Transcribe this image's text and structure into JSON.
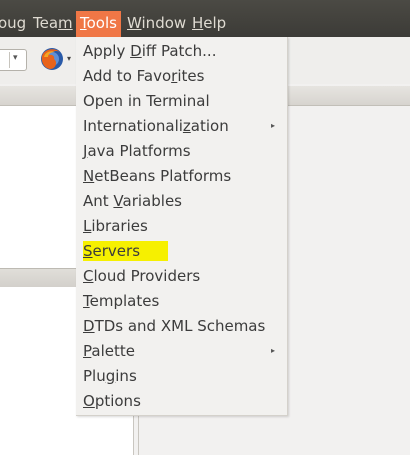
{
  "menubar": {
    "items": [
      {
        "prefix": "",
        "mnemonic": "",
        "suffix": "oug"
      },
      {
        "prefix": "Tea",
        "mnemonic": "m",
        "suffix": ""
      },
      {
        "prefix": "",
        "mnemonic": "T",
        "suffix": "ools"
      },
      {
        "prefix": "",
        "mnemonic": "W",
        "suffix": "indow"
      },
      {
        "prefix": "",
        "mnemonic": "H",
        "suffix": "elp"
      }
    ]
  },
  "tools_menu": {
    "items": [
      {
        "prefix": "Apply ",
        "mnemonic": "D",
        "suffix": "iff Patch..."
      },
      {
        "prefix": "Add to Favo",
        "mnemonic": "r",
        "suffix": "ites"
      },
      {
        "prefix": "Open in Terminal",
        "mnemonic": "",
        "suffix": ""
      },
      {
        "prefix": "Internationali",
        "mnemonic": "z",
        "suffix": "ation",
        "submenu": "▸"
      },
      {
        "prefix": "",
        "mnemonic": "J",
        "suffix": "ava Platforms"
      },
      {
        "prefix": "",
        "mnemonic": "N",
        "suffix": "etBeans Platforms"
      },
      {
        "prefix": "Ant ",
        "mnemonic": "V",
        "suffix": "ariables"
      },
      {
        "prefix": "",
        "mnemonic": "L",
        "suffix": "ibraries"
      },
      {
        "prefix": "",
        "mnemonic": "S",
        "suffix": "ervers"
      },
      {
        "prefix": "",
        "mnemonic": "C",
        "suffix": "loud Providers"
      },
      {
        "prefix": "",
        "mnemonic": "T",
        "suffix": "emplates"
      },
      {
        "prefix": "",
        "mnemonic": "D",
        "suffix": "TDs and XML Schemas"
      },
      {
        "prefix": "",
        "mnemonic": "P",
        "suffix": "alette",
        "submenu": "▸"
      },
      {
        "prefix": "Plu",
        "mnemonic": "g",
        "suffix": "ins"
      },
      {
        "prefix": "",
        "mnemonic": "O",
        "suffix": "ptions"
      }
    ]
  },
  "toolbar": {
    "combo_arrow": "▾",
    "firefox_arrow": "▾"
  },
  "colors": {
    "menubar_bg": "#3c3b37",
    "active_menu": "#f07746",
    "highlight": "#f6f000"
  }
}
